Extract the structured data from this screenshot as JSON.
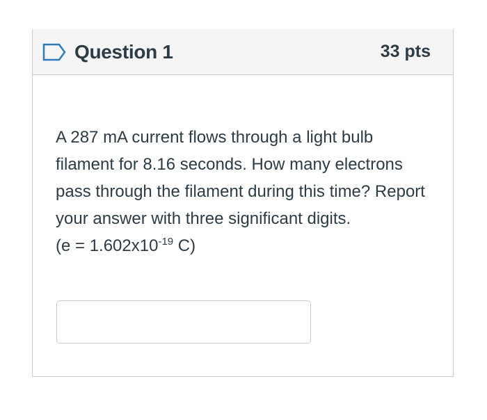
{
  "question": {
    "title": "Question 1",
    "points": "33 pts",
    "flag_icon": "flag-question-icon",
    "text_line_1": "A 287 mA current flows through a light bulb filament for 8.16 seconds. How many electrons pass through the filament during this time? Report your answer with three significant digits.",
    "constant_prefix": "(e = 1.602x10",
    "constant_exponent": "-19",
    "constant_suffix": " C)"
  },
  "answer": {
    "value": "",
    "placeholder": ""
  },
  "colors": {
    "text": "#2d3b45",
    "header_bg": "#f5f5f5",
    "border": "#c7cdd1",
    "flag_stroke": "#2b7abc"
  }
}
